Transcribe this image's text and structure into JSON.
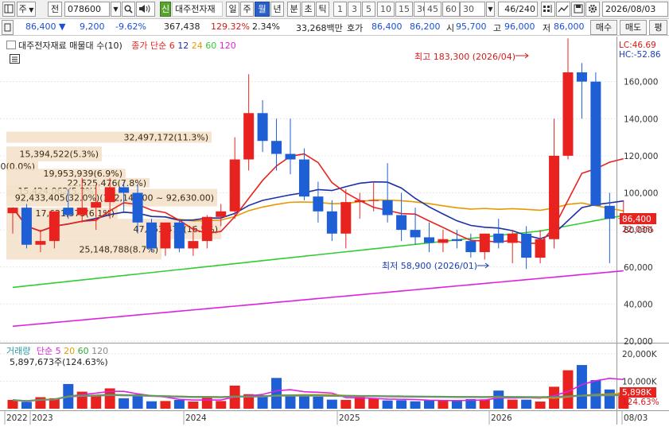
{
  "toolbar": {
    "market_label": "주",
    "prev_label": "전",
    "code": "078600",
    "sin_label": "신",
    "stock_name": "대주전자재",
    "periods": [
      "일",
      "주",
      "월",
      "년",
      "분",
      "초",
      "틱"
    ],
    "selected_period": "월",
    "minutes": [
      "1",
      "3",
      "5",
      "10",
      "15",
      "30",
      "45",
      "60"
    ],
    "interval_value": "30",
    "count": "46",
    "count_total": "/240",
    "date": "2026/08/03"
  },
  "quote": {
    "price": "86,400",
    "change": "9,200",
    "change_pct": "-9.62%",
    "volume": "367,438",
    "volume_ratio": "129.32%",
    "turnover_pct": "2.34%",
    "amount": "33,268백만",
    "ask_label": "호가",
    "ask": "86,400",
    "bid": "86,200",
    "open_label": "시",
    "open": "95,700",
    "high_label": "고",
    "high": "96,000",
    "low_label": "저",
    "low": "86,000",
    "buy_button": "매수",
    "sell_button": "매도",
    "eval_button": "평"
  },
  "legend": {
    "title": "대주전자재료 매물대 수(10)",
    "ma_label": "종가 단순",
    "ma_periods": [
      "6",
      "12",
      "24",
      "60",
      "120"
    ],
    "lc": "LC:46.69",
    "hc": "HC:-52.86"
  },
  "annotations": {
    "high": "최고 183,300 (2026/04)",
    "low": "최저 58,900 (2026/01)"
  },
  "price_axis": {
    "ticks": [
      "160,000",
      "140,000",
      "120,000",
      "100,000",
      "80,000",
      "60,000",
      "40,000",
      "20,000"
    ],
    "current_price": "86,400",
    "current_pct": "22.03%"
  },
  "volume_profile": [
    {
      "text": "32,497,172(11.3%)"
    },
    {
      "text": "15,394,522(5.3%)"
    },
    {
      "text": "0(0.0%)"
    },
    {
      "text": "19,953,939(6.9%)"
    },
    {
      "text": "22,525,476(7.8%)"
    },
    {
      "text": "15,424,062(5.3%)"
    },
    {
      "text": "92,433,405(32.0%)(102,140.00 ~ 92,630.00)"
    },
    {
      "text": "17,621,573(6.1%)"
    },
    {
      "text": "47,653,477(16.5%)"
    },
    {
      "text": "25,148,788(8.7%)"
    }
  ],
  "volume_panel": {
    "title": "거래량",
    "ma_label": "단순",
    "ma_periods": [
      "5",
      "20",
      "60",
      "120"
    ],
    "last_volume": "5,897,673주(124.63%)",
    "axis_ticks": [
      "20,000K",
      "10,000K"
    ],
    "current_volume": "5,898K",
    "current_pct": "124.63%"
  },
  "x_axis": [
    "2022",
    "2023",
    "2024",
    "2025",
    "2026",
    "08/03"
  ],
  "colors": {
    "up": "#e8231f",
    "down": "#1f5fd6",
    "ma6": "#e8231f",
    "ma12": "#1c2fa6",
    "ma24": "#e69a00",
    "ma60": "#33cc33",
    "ma120": "#dd22dd"
  },
  "chart_data": {
    "type": "candlestick",
    "periods": [
      "2022/12",
      "2023/01",
      "2023/02",
      "2023/03",
      "2023/04",
      "2023/05",
      "2023/06",
      "2023/07",
      "2023/08",
      "2023/09",
      "2023/10",
      "2023/11",
      "2023/12",
      "2024/01",
      "2024/02",
      "2024/03",
      "2024/04",
      "2024/05",
      "2024/06",
      "2024/07",
      "2024/08",
      "2024/09",
      "2024/10",
      "2024/11",
      "2024/12",
      "2025/01",
      "2025/02",
      "2025/03",
      "2025/04",
      "2025/05",
      "2025/06",
      "2025/07",
      "2025/08",
      "2025/09",
      "2025/10",
      "2025/11",
      "2025/12",
      "2026/01",
      "2026/02",
      "2026/03",
      "2026/04",
      "2026/05",
      "2026/06",
      "2026/07",
      "2026/08"
    ],
    "open": [
      89000,
      92000,
      72000,
      74000,
      92000,
      88000,
      92000,
      95000,
      103000,
      100000,
      84000,
      70000,
      84000,
      70000,
      74000,
      87000,
      90000,
      118000,
      143000,
      128000,
      121000,
      118000,
      98000,
      90000,
      78000,
      95000,
      96000,
      96000,
      88000,
      80000,
      76000,
      73000,
      75000,
      74000,
      68000,
      78000,
      73000,
      78000,
      65000,
      75000,
      120000,
      165000,
      160000,
      93000,
      86000
    ],
    "high": [
      90000,
      94000,
      80000,
      88000,
      102000,
      108000,
      104000,
      108000,
      106000,
      104000,
      86000,
      80000,
      86000,
      82000,
      88000,
      94000,
      130000,
      164000,
      150000,
      140000,
      140000,
      124000,
      106000,
      96000,
      102000,
      100000,
      106000,
      116000,
      100000,
      92000,
      84000,
      80000,
      80000,
      78000,
      78000,
      86000,
      80000,
      82000,
      80000,
      140000,
      183300,
      170000,
      165000,
      100000,
      96000
    ],
    "low": [
      78000,
      70000,
      68000,
      70000,
      86000,
      84000,
      80000,
      86000,
      90000,
      78000,
      68000,
      66000,
      68000,
      66000,
      70000,
      82000,
      86000,
      112000,
      122000,
      112000,
      110000,
      96000,
      84000,
      74000,
      70000,
      86000,
      90000,
      84000,
      74000,
      72000,
      68000,
      68000,
      70000,
      65000,
      64000,
      70000,
      62000,
      58900,
      62000,
      70000,
      118000,
      140000,
      120000,
      62000,
      86000
    ],
    "close": [
      92000,
      72000,
      74000,
      90000,
      88000,
      92000,
      95000,
      103000,
      100000,
      84000,
      70000,
      84000,
      70000,
      74000,
      87000,
      90000,
      118000,
      143000,
      128000,
      121000,
      118000,
      98000,
      90000,
      78000,
      95000,
      96000,
      96000,
      88000,
      80000,
      76000,
      73000,
      75000,
      74000,
      68000,
      78000,
      73000,
      78000,
      65000,
      75000,
      120000,
      165000,
      160000,
      93000,
      86000,
      86400
    ],
    "volume": [
      3200,
      2500,
      4200,
      3800,
      9000,
      6200,
      5100,
      7400,
      3800,
      4600,
      2700,
      2800,
      3200,
      2600,
      4500,
      2800,
      8400,
      5300,
      4900,
      11200,
      4800,
      4700,
      4400,
      3300,
      3200,
      4300,
      3600,
      3000,
      3100,
      2700,
      3000,
      3100,
      2900,
      3500,
      3400,
      6600,
      3300,
      3300,
      2600,
      8000,
      14000,
      15900,
      10400,
      7000,
      5898
    ],
    "y_range": [
      20000,
      180000
    ],
    "volume_range": [
      0,
      22000
    ],
    "volume_unit": "K"
  }
}
